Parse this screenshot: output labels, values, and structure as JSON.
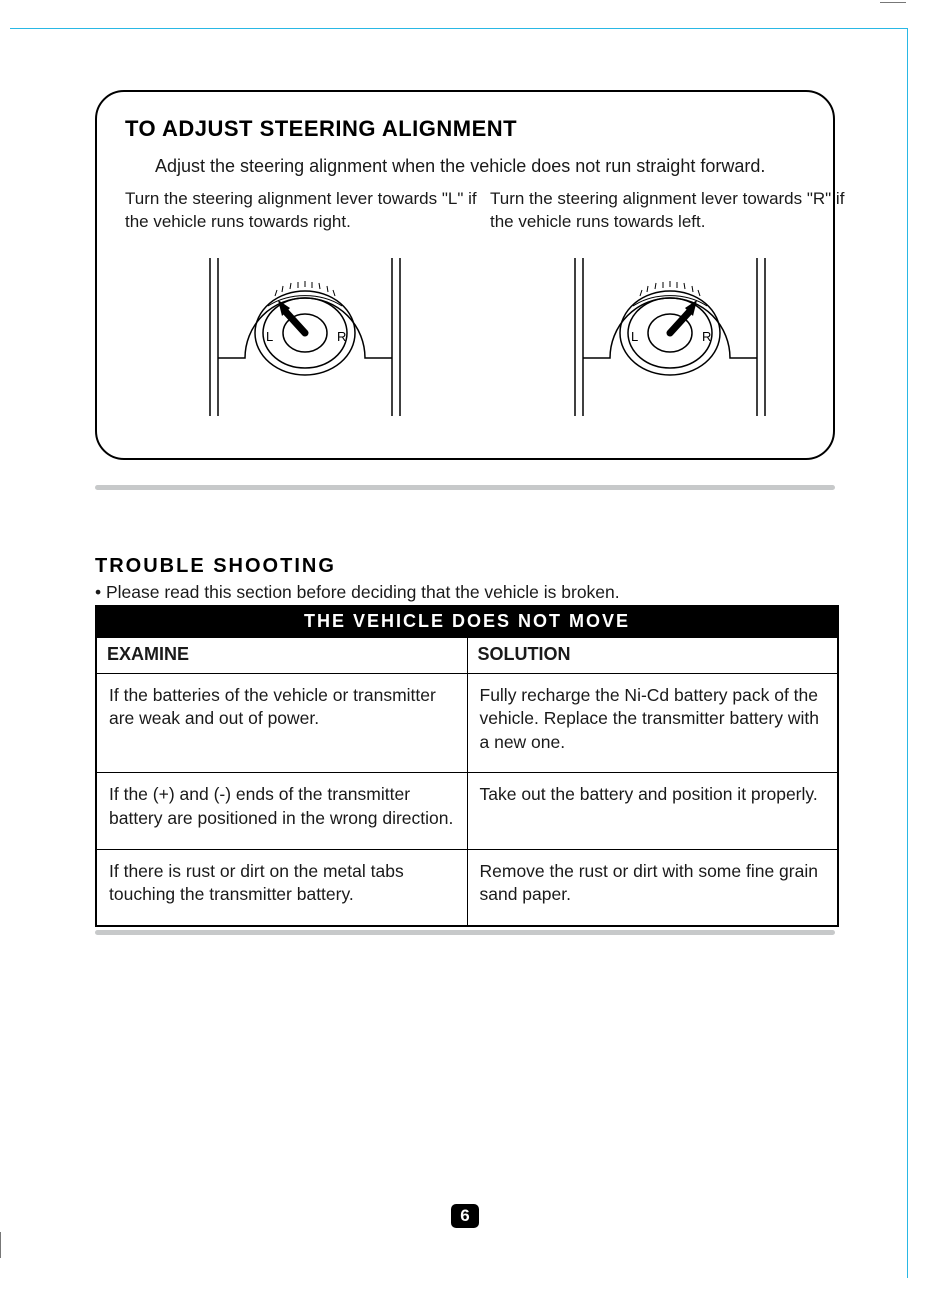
{
  "panel": {
    "title": "TO ADJUST STEERING ALIGNMENT",
    "subtitle": "Adjust the steering alignment when the vehicle does not run straight forward.",
    "left_text": "Turn the steering alignment lever towards \"L\" if the vehicle runs towards right.",
    "right_text": "Turn the steering alignment lever towards \"R\" if the vehicle runs towards left.",
    "dial_L": "L",
    "dial_R": "R"
  },
  "troubleshoot": {
    "heading": "TROUBLE SHOOTING",
    "note": "• Please read this section before deciding that the vehicle is broken.",
    "table_title": "THE VEHICLE DOES NOT MOVE",
    "col1": "EXAMINE",
    "col2": "SOLUTION",
    "rows": [
      {
        "examine": "If the batteries of the vehicle or transmitter are weak and out of power.",
        "solution": "Fully recharge the Ni-Cd battery pack of the vehicle. Replace the transmitter battery with a new one."
      },
      {
        "examine": "If the (+) and (-) ends of the transmitter battery are positioned in the wrong direction.",
        "solution": "Take out the battery and position it properly."
      },
      {
        "examine": "If there is rust or dirt on the metal tabs touching the transmitter battery.",
        "solution": "Remove the rust or dirt with some fine grain sand paper."
      }
    ]
  },
  "page_number": "6"
}
